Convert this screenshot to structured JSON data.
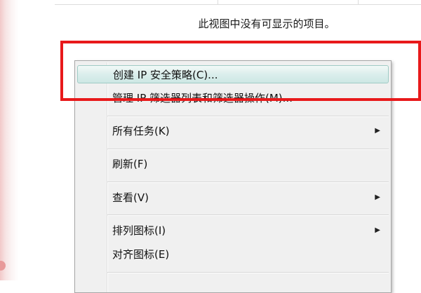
{
  "view": {
    "empty_message": "此视图中没有可显示的项目。"
  },
  "context_menu": {
    "items": [
      {
        "label": "创建 IP 安全策略(C)...",
        "has_submenu": false,
        "highlighted": true
      },
      {
        "label": "管理 IP 筛选器列表和筛选器操作(M)...",
        "has_submenu": false,
        "highlighted": false
      },
      {
        "label": "所有任务(K)",
        "has_submenu": true,
        "highlighted": false
      },
      {
        "label": "刷新(F)",
        "has_submenu": false,
        "highlighted": false
      },
      {
        "label": "查看(V)",
        "has_submenu": true,
        "highlighted": false
      },
      {
        "label": "排列图标(I)",
        "has_submenu": true,
        "highlighted": false
      },
      {
        "label": "对齐图标(E)",
        "has_submenu": false,
        "highlighted": false
      }
    ],
    "submenu_icon": "triangle-right-icon"
  },
  "annotation": {
    "highlight_color": "#e8191b"
  }
}
